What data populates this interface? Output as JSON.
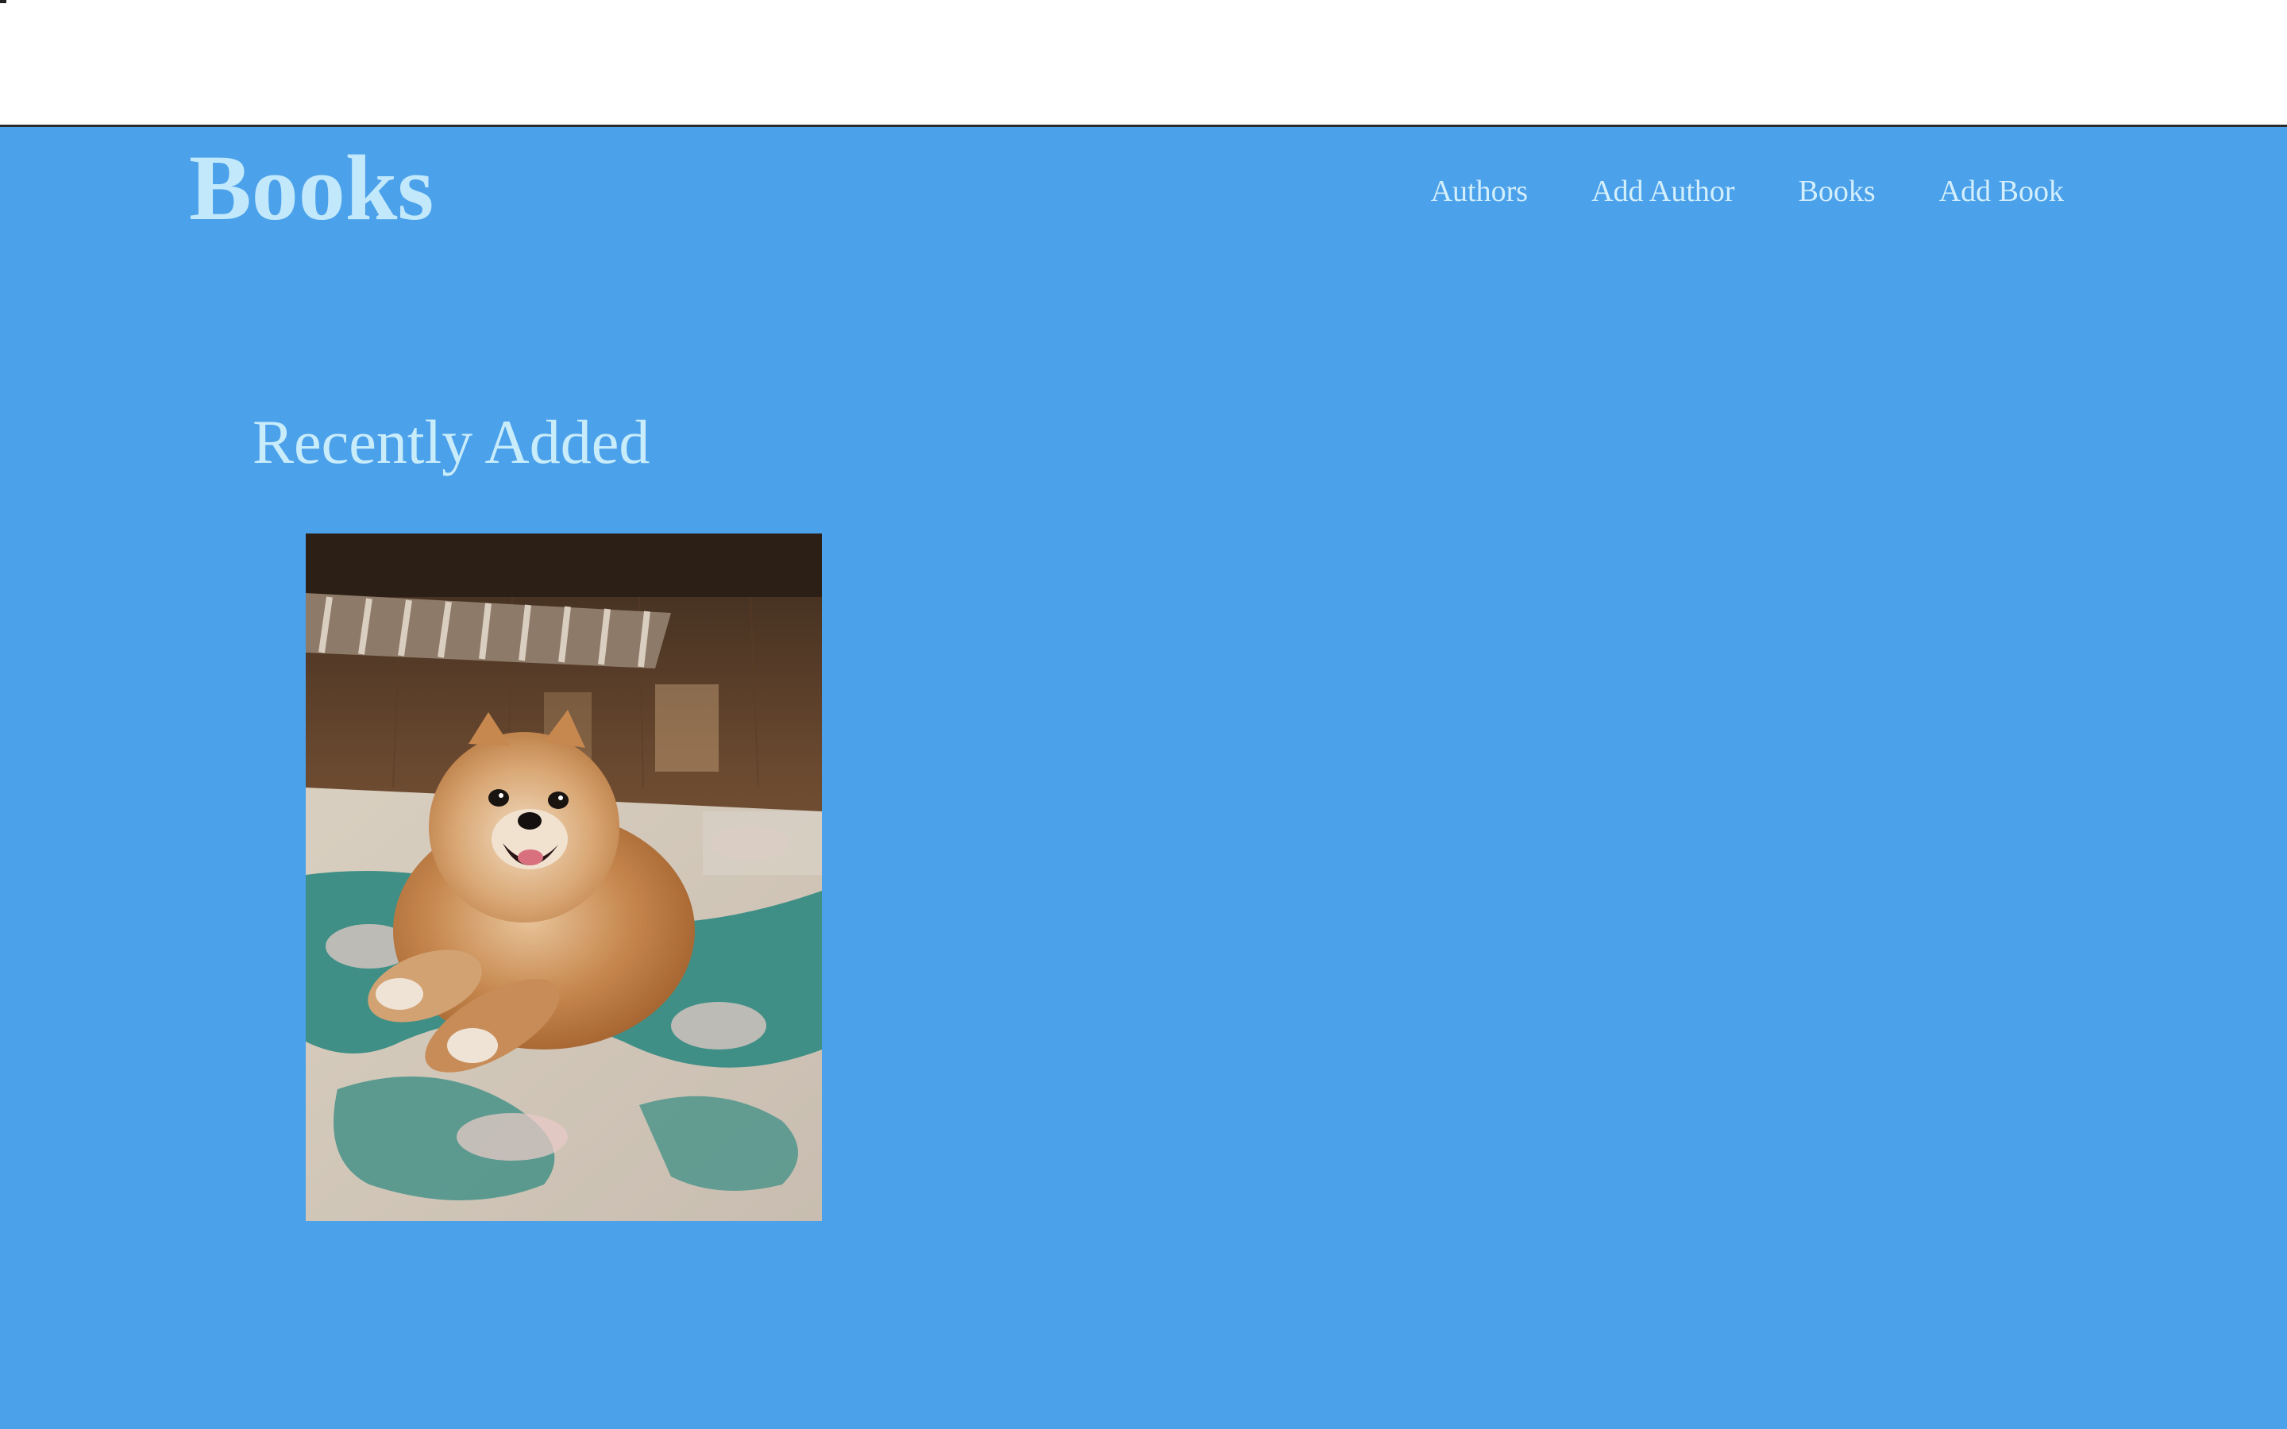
{
  "header": {
    "brand": "Books",
    "nav": [
      {
        "label": "Authors"
      },
      {
        "label": "Add Author"
      },
      {
        "label": "Books"
      },
      {
        "label": "Add Book"
      }
    ]
  },
  "main": {
    "section_title": "Recently Added",
    "books": [
      {
        "cover_description": "photo-cover-pomeranian-dog"
      }
    ]
  },
  "colors": {
    "background": "#4ba1ea",
    "text": "#c9ecfb"
  }
}
